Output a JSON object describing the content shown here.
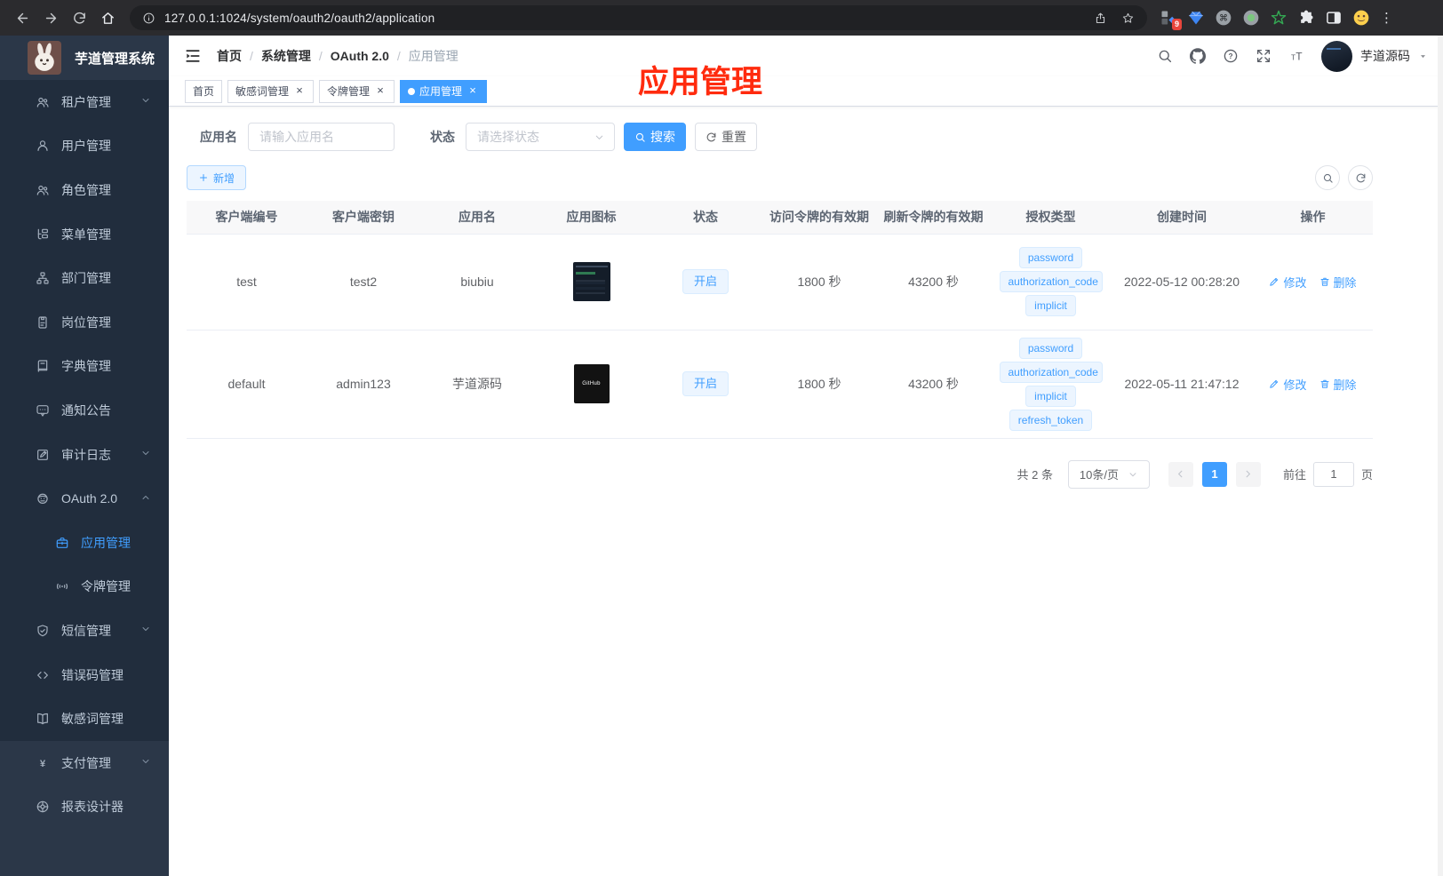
{
  "browser": {
    "url": "127.0.0.1:1024/system/oauth2/oauth2/application",
    "nav_icons": [
      "back-icon",
      "forward-icon",
      "reload-icon",
      "home-icon"
    ],
    "pill_left_icon": "info-icon",
    "pill_right_icons": [
      "share-icon",
      "bookmark-star-icon"
    ],
    "extension_icons": [
      "tab-group-icon",
      "gem-icon",
      "command-circle-icon",
      "record-circle-icon",
      "stylus-star-icon",
      "puzzle-icon",
      "split-screen-icon",
      "emoji-icon"
    ],
    "extension_badge": "9"
  },
  "sidebar": {
    "logo_title": "芋道管理系统",
    "items": [
      {
        "key": "tenant",
        "icon": "users-icon",
        "label": "租户管理",
        "chevron": "down"
      },
      {
        "key": "user",
        "icon": "user-icon",
        "label": "用户管理"
      },
      {
        "key": "role",
        "icon": "role-icon",
        "label": "角色管理"
      },
      {
        "key": "menu",
        "icon": "menu-list-icon",
        "label": "菜单管理"
      },
      {
        "key": "dept",
        "icon": "org-chart-icon",
        "label": "部门管理"
      },
      {
        "key": "post",
        "icon": "id-badge-icon",
        "label": "岗位管理"
      },
      {
        "key": "dict",
        "icon": "dictionary-icon",
        "label": "字典管理"
      },
      {
        "key": "notice",
        "icon": "announcement-icon",
        "label": "通知公告"
      },
      {
        "key": "audit",
        "icon": "audit-log-icon",
        "label": "审计日志",
        "chevron": "down"
      },
      {
        "key": "oauth2",
        "icon": "robot-icon",
        "label": "OAuth 2.0",
        "chevron": "up"
      },
      {
        "key": "oauth2-application",
        "icon": "briefcase-icon",
        "label": "应用管理",
        "level": 2,
        "active": true
      },
      {
        "key": "oauth2-token",
        "icon": "signal-icon",
        "label": "令牌管理",
        "level": 2
      },
      {
        "key": "sms",
        "icon": "shield-check-icon",
        "label": "短信管理",
        "chevron": "down"
      },
      {
        "key": "error-code",
        "icon": "code-icon",
        "label": "错误码管理"
      },
      {
        "key": "sensitive-word",
        "icon": "open-book-icon",
        "label": "敏感词管理"
      },
      {
        "key": "pay",
        "icon": "yen-icon",
        "label": "支付管理",
        "chevron": "down",
        "section": "root"
      },
      {
        "key": "report-designer",
        "icon": "wheel-icon",
        "label": "报表设计器",
        "section": "root"
      }
    ]
  },
  "navbar": {
    "breadcrumb": [
      "首页",
      "系统管理",
      "OAuth 2.0",
      "应用管理"
    ],
    "action_icons": [
      "search-icon",
      "github-icon",
      "help-icon",
      "fullscreen-icon",
      "font-size-icon"
    ],
    "username": "芋道源码"
  },
  "tags_view": {
    "tags": [
      {
        "label": "首页"
      },
      {
        "label": "敏感词管理",
        "closable": true
      },
      {
        "label": "令牌管理",
        "closable": true
      },
      {
        "label": "应用管理",
        "closable": true,
        "active": true
      }
    ]
  },
  "annotation": {
    "text": "应用管理",
    "color": "#ff2b0e"
  },
  "filter": {
    "name_label": "应用名",
    "name_placeholder": "请输入应用名",
    "status_label": "状态",
    "status_placeholder": "请选择状态",
    "search_label": "搜索",
    "reset_label": "重置",
    "add_label": "新增"
  },
  "table": {
    "headers": [
      "客户端编号",
      "客户端密钥",
      "应用名",
      "应用图标",
      "状态",
      "访问令牌的有效期",
      "刷新令牌的有效期",
      "授权类型",
      "创建时间",
      "操作"
    ],
    "rows": [
      {
        "client_id": "test",
        "client_secret": "test2",
        "app_name": "biubiu",
        "app_icon": "dashboard-screenshot-thumb",
        "app_icon_text": "",
        "status": "开启",
        "access_token_validity": "1800 秒",
        "refresh_token_validity": "43200 秒",
        "grant_types": [
          "password",
          "authorization_code",
          "implicit"
        ],
        "created_at": "2022-05-12 00:28:20"
      },
      {
        "client_id": "default",
        "client_secret": "admin123",
        "app_name": "芋道源码",
        "app_icon": "github-logo-thumb",
        "app_icon_text": "GitHub",
        "status": "开启",
        "access_token_validity": "1800 秒",
        "refresh_token_validity": "43200 秒",
        "grant_types": [
          "password",
          "authorization_code",
          "implicit",
          "refresh_token"
        ],
        "created_at": "2022-05-11 21:47:12"
      }
    ],
    "actions": {
      "edit": "修改",
      "delete": "删除"
    }
  },
  "pagination": {
    "total": "共 2 条",
    "page_size": "10条/页",
    "current_page": "1",
    "goto_label": "前往",
    "goto_value": "1",
    "page_unit": "页"
  },
  "colors": {
    "accent": "#409eff",
    "annotation_red": "#ff2b0e",
    "sidebar_bg": "#212d3d",
    "sidebar_section_bg": "#2b3748",
    "tag_bg": "#ecf5ff",
    "tag_border": "#d9ecff"
  }
}
